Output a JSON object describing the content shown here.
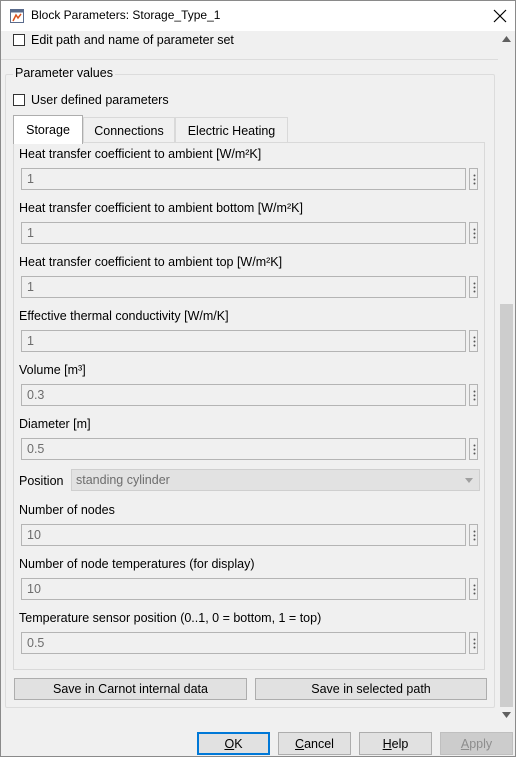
{
  "window": {
    "title": "Block Parameters: Storage_Type_1"
  },
  "top_options": {
    "edit_path_label": "Edit path and name of parameter set"
  },
  "group": {
    "title": "Parameter values",
    "user_defined_label": "User defined parameters"
  },
  "tabs": [
    {
      "label": "Storage",
      "active": true
    },
    {
      "label": "Connections",
      "active": false
    },
    {
      "label": "Electric Heating",
      "active": false
    }
  ],
  "params": [
    {
      "label": "Heat transfer coefficient to ambient [W/m²K]",
      "value": "1"
    },
    {
      "label": "Heat transfer coefficient to ambient bottom [W/m²K]",
      "value": "1"
    },
    {
      "label": "Heat transfer coefficient to ambient top [W/m²K]",
      "value": "1"
    },
    {
      "label": "Effective thermal conductivity [W/m/K]",
      "value": "1"
    },
    {
      "label": "Volume [m³]",
      "value": "0.3"
    },
    {
      "label": "Diameter [m]",
      "value": "0.5"
    }
  ],
  "position": {
    "label": "Position",
    "value": "standing cylinder"
  },
  "params2": [
    {
      "label": "Number of nodes",
      "value": "10"
    },
    {
      "label": "Number of node temperatures (for display)",
      "value": "10"
    },
    {
      "label": "Temperature sensor position (0..1, 0 = bottom, 1 = top)",
      "value": "0.5"
    }
  ],
  "actions": {
    "save_internal": "Save in Carnot internal data",
    "save_selected": "Save in selected path"
  },
  "dialog_buttons": {
    "ok": {
      "access": "O",
      "rest": "K"
    },
    "cancel": {
      "access": "C",
      "rest": "ancel"
    },
    "help": {
      "access": "H",
      "rest": "elp"
    },
    "apply": {
      "access": "A",
      "rest": "pply",
      "disabled": true
    }
  },
  "colors": {
    "default_button_border": "#0078d7",
    "field_bg": "#f0f0f0",
    "disabled_text": "#6d6d6d"
  },
  "icons": [
    "simulink-block-icon",
    "close-icon",
    "dots-icon",
    "chevron-down-icon",
    "scroll-up-arrow-icon",
    "scroll-down-arrow-icon"
  ]
}
